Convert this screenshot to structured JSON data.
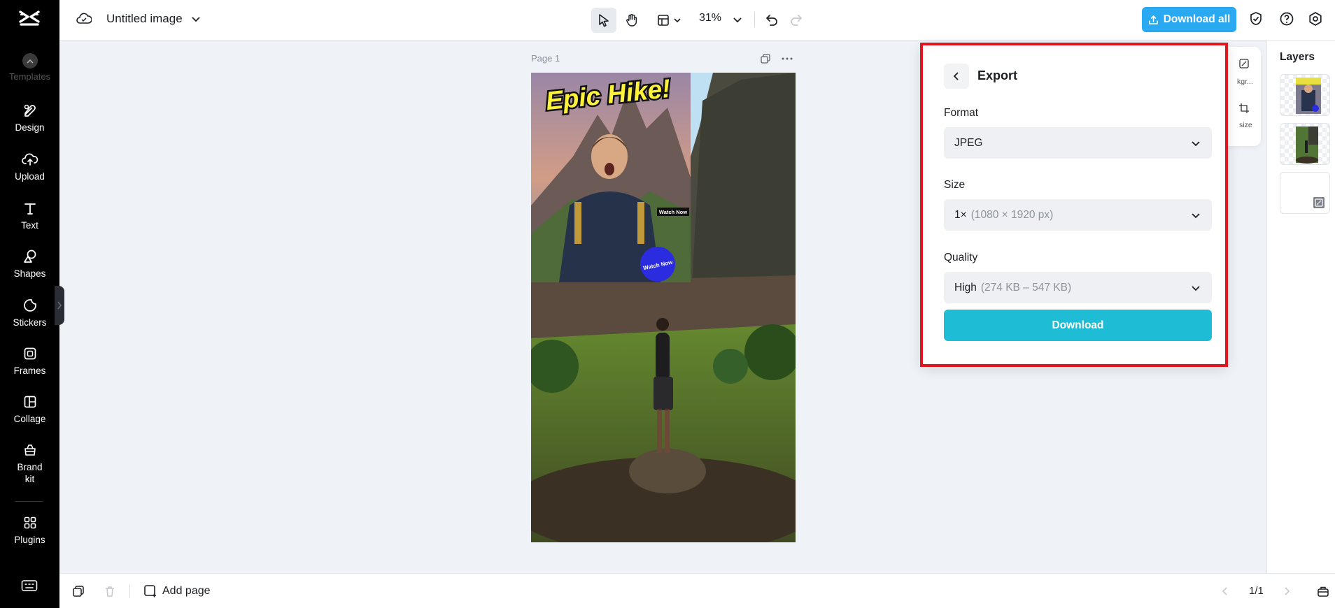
{
  "app": {
    "doc_title": "Untitled image",
    "zoom": "31%",
    "download_all_label": "Download all"
  },
  "sidebar": {
    "templates_label": "Templates",
    "items": [
      {
        "label": "Design",
        "icon": "design-icon"
      },
      {
        "label": "Upload",
        "icon": "upload-icon"
      },
      {
        "label": "Text",
        "icon": "text-icon"
      },
      {
        "label": "Shapes",
        "icon": "shapes-icon"
      },
      {
        "label": "Stickers",
        "icon": "stickers-icon"
      },
      {
        "label": "Frames",
        "icon": "frames-icon"
      },
      {
        "label": "Collage",
        "icon": "collage-icon"
      },
      {
        "label": "Brand kit",
        "icon": "brand-kit-icon"
      },
      {
        "label": "Plugins",
        "icon": "plugins-icon"
      }
    ]
  },
  "canvas": {
    "page_label": "Page 1",
    "art_headline": "Epic Hike!",
    "art_tag": "Watch Now",
    "art_badge": "Watch Now"
  },
  "side_panel": {
    "item1_label": "kgr...",
    "item2_label": "size"
  },
  "export": {
    "title": "Export",
    "format_label": "Format",
    "format_value": "JPEG",
    "size_label": "Size",
    "size_value": "1×",
    "size_detail": "(1080 × 1920 px)",
    "quality_label": "Quality",
    "quality_value": "High",
    "quality_detail": "(274 KB – 547 KB)",
    "download_label": "Download"
  },
  "layers": {
    "title": "Layers"
  },
  "bottombar": {
    "add_page_label": "Add page",
    "pager": "1/1"
  },
  "colors": {
    "accent": "#28a9f1",
    "download_button": "#1fbcd6",
    "highlight": "#e0161e",
    "sidebar_bg": "#000000"
  }
}
